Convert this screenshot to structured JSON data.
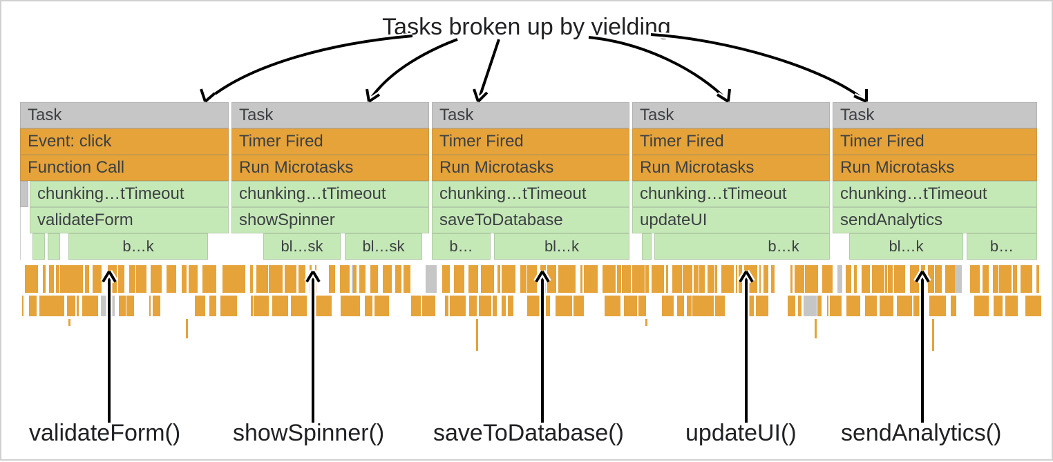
{
  "title": "Tasks broken up by yielding",
  "columns": [
    {
      "task": "Task",
      "event": "Event: click",
      "call": "Function Call",
      "chunk": "chunking…tTimeout",
      "fn": "validateForm",
      "label": "validateForm()",
      "sub": [
        "b…k"
      ]
    },
    {
      "task": "Task",
      "event": "Timer Fired",
      "call": "Run Microtasks",
      "chunk": "chunking…tTimeout",
      "fn": "showSpinner",
      "label": "showSpinner()",
      "sub": [
        "bl…sk",
        "bl…sk"
      ]
    },
    {
      "task": "Task",
      "event": "Timer Fired",
      "call": "Run Microtasks",
      "chunk": "chunking…tTimeout",
      "fn": "saveToDatabase",
      "label": "saveToDatabase()",
      "sub": [
        "b…",
        "bl…k"
      ]
    },
    {
      "task": "Task",
      "event": "Timer Fired",
      "call": "Run Microtasks",
      "chunk": "chunking…tTimeout",
      "fn": "updateUI",
      "label": "updateUI()",
      "sub": [
        "b…k"
      ]
    },
    {
      "task": "Task",
      "event": "Timer Fired",
      "call": "Run Microtasks",
      "chunk": "chunking…tTimeout",
      "fn": "sendAnalytics",
      "label": "sendAnalytics()",
      "sub": [
        "bl…k",
        "b…"
      ]
    }
  ],
  "colors": {
    "grey": "#c6c6c6",
    "amber": "#e5a33a",
    "green": "#c5e8b7"
  }
}
